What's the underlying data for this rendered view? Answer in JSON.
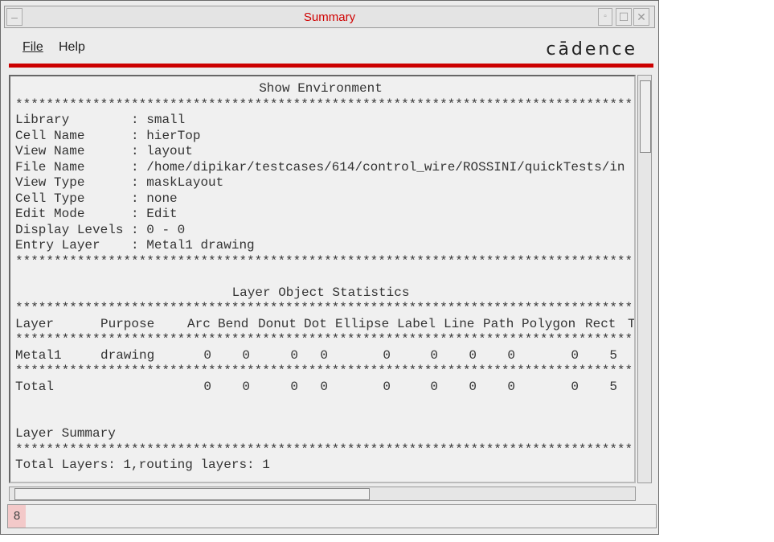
{
  "window": {
    "title": "Summary"
  },
  "menu": {
    "file": "File",
    "help": "Help",
    "logo": "cādence"
  },
  "env": {
    "heading": "Show Environment",
    "stars": "********************************************************************************",
    "rows": [
      {
        "label": "Library       ",
        "value": "small"
      },
      {
        "label": "Cell Name     ",
        "value": "hierTop"
      },
      {
        "label": "View Name     ",
        "value": "layout"
      },
      {
        "label": "File Name     ",
        "value": "/home/dipikar/testcases/614/control_wire/ROSSINI/quickTests/in"
      },
      {
        "label": "View Type     ",
        "value": "maskLayout"
      },
      {
        "label": "Cell Type     ",
        "value": "none"
      },
      {
        "label": "Edit Mode     ",
        "value": "Edit"
      },
      {
        "label": "Display Levels",
        "value": "0 - 0"
      },
      {
        "label": "Entry Layer   ",
        "value": "Metal1 drawing"
      }
    ]
  },
  "stats": {
    "heading": "Layer Object Statistics",
    "columns": [
      "Layer",
      "Purpose",
      "Arc",
      "Bend",
      "Donut",
      "Dot",
      "Ellipse",
      "Label",
      "Line",
      "Path",
      "Polygon",
      "Rect",
      "T"
    ],
    "rows": [
      {
        "layer": "Metal1",
        "purpose": "drawing",
        "values": [
          "0",
          "0",
          "0",
          "0",
          "0",
          "0",
          "0",
          "0",
          "0",
          "5"
        ]
      }
    ],
    "total": {
      "label": "Total",
      "values": [
        "0",
        "0",
        "0",
        "0",
        "0",
        "0",
        "0",
        "0",
        "0",
        "5"
      ]
    }
  },
  "summary": {
    "heading": "Layer Summary",
    "text": "Total Layers: 1,routing layers: 1"
  },
  "status": {
    "number": "8"
  }
}
